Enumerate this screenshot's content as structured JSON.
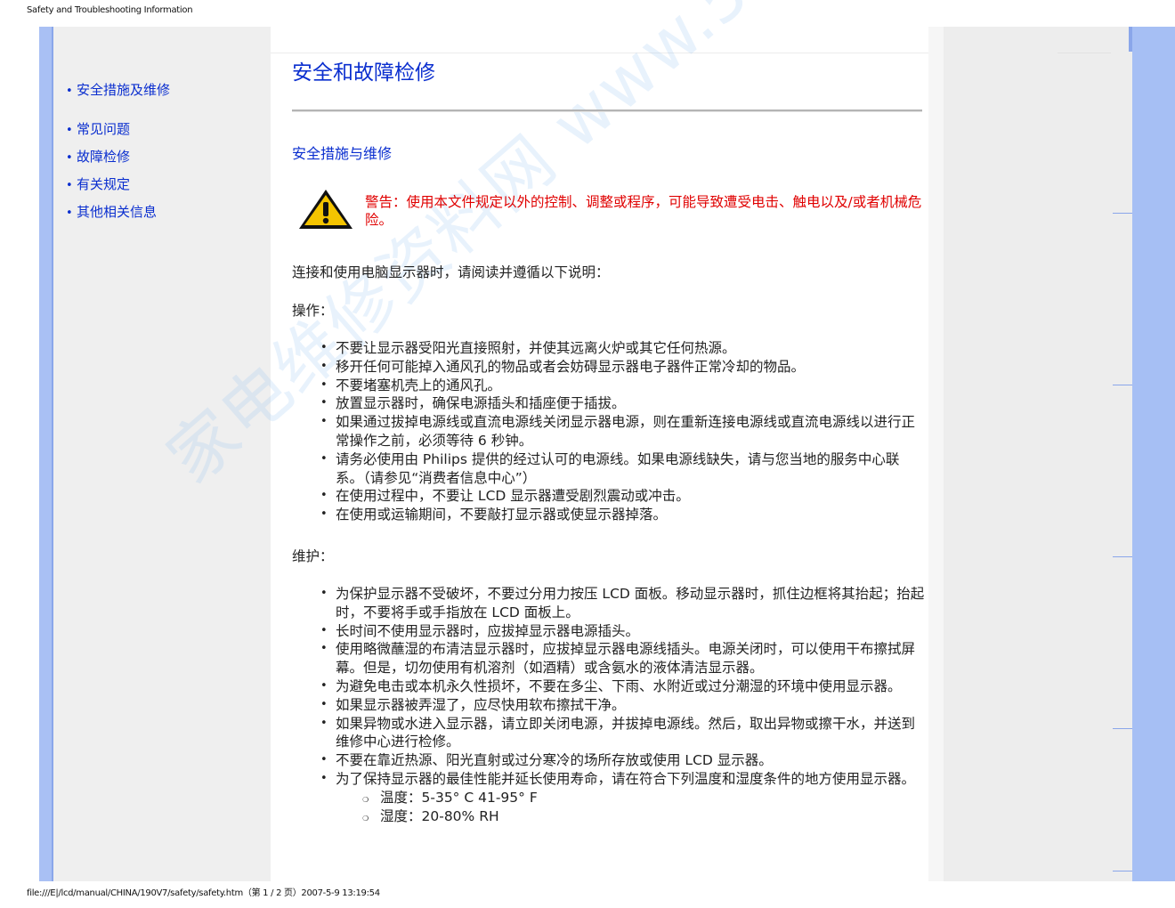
{
  "print_header": "Safety and Troubleshooting Information",
  "print_footer": "file:///E|/lcd/manual/CHINA/190V7/safety/safety.htm（第 1 / 2 页）2007-5-9 13:19:54",
  "watermark": "家电维修资料网 www.51WS2010.com",
  "sidebar": {
    "items": [
      {
        "label": "安全措施及维修"
      },
      {
        "label": "常见问题"
      },
      {
        "label": "故障检修"
      },
      {
        "label": "有关规定"
      },
      {
        "label": "其他相关信息"
      }
    ]
  },
  "main": {
    "title": "安全和故障检修",
    "section_title": "安全措施与维修",
    "warning": "警告：使用本文件规定以外的控制、调整或程序，可能导致遭受电击、触电以及/或者机械危险。",
    "intro": "连接和使用电脑显示器时，请阅读并遵循以下说明：",
    "operation_heading": "操作：",
    "operation_items": [
      "不要让显示器受阳光直接照射，并使其远离火炉或其它任何热源。",
      "移开任何可能掉入通风孔的物品或者会妨碍显示器电子器件正常冷却的物品。",
      "不要堵塞机壳上的通风孔。",
      "放置显示器时，确保电源插头和插座便于插拔。",
      "如果通过拔掉电源线或直流电源线关闭显示器电源，则在重新连接电源线或直流电源线以进行正常操作之前，必须等待 6 秒钟。",
      "请务必使用由 Philips 提供的经过认可的电源线。如果电源线缺失，请与您当地的服务中心联系。（请参见“消费者信息中心”）",
      "在使用过程中，不要让 LCD 显示器遭受剧烈震动或冲击。",
      "在使用或运输期间，不要敲打显示器或使显示器掉落。"
    ],
    "maintenance_heading": "维护：",
    "maintenance_items": [
      "为保护显示器不受破坏，不要过分用力按压 LCD 面板。移动显示器时，抓住边框将其抬起；抬起时，不要将手或手指放在 LCD 面板上。",
      "长时间不使用显示器时，应拔掉显示器电源插头。",
      "使用略微蘸湿的布清洁显示器时，应拔掉显示器电源线插头。电源关闭时，可以使用干布擦拭屏幕。但是，切勿使用有机溶剂（如酒精）或含氨水的液体清洁显示器。",
      "为避免电击或本机永久性损坏，不要在多尘、下雨、水附近或过分潮湿的环境中使用显示器。",
      "如果显示器被弄湿了，应尽快用软布擦拭干净。",
      "如果异物或水进入显示器，请立即关闭电源，并拔掉电源线。然后，取出异物或擦干水，并送到维修中心进行检修。",
      "不要在靠近热源、阳光直射或过分寒冷的场所存放或使用 LCD 显示器。",
      "为了保持显示器的最佳性能并延长使用寿命，请在符合下列温度和湿度条件的地方使用显示器。"
    ],
    "conditions": [
      "温度：5-35° C 41-95° F",
      "湿度：20-80% RH"
    ]
  },
  "colors": {
    "link": "#0a2ecf",
    "warning": "#e00000",
    "frame_blue": "#a9c0f4",
    "nav_bg": "#efefef"
  },
  "icons": {
    "warning": "warning-triangle-icon"
  }
}
